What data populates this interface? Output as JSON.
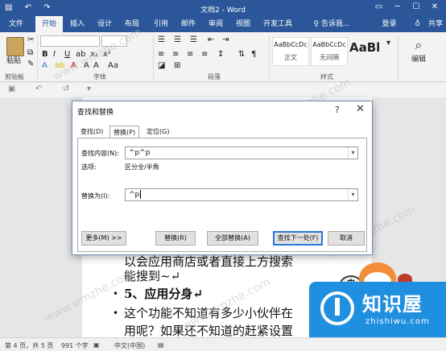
{
  "window": {
    "title": "文档2 - Word"
  },
  "ribbon_tabs": [
    "文件",
    "开始",
    "插入",
    "设计",
    "布局",
    "引用",
    "邮件",
    "审阅",
    "视图",
    "开发工具"
  ],
  "tell_me": "告诉我...",
  "account": {
    "login": "登录",
    "share": "共享"
  },
  "ribbon": {
    "paste_label": "粘贴",
    "clipboard_group": "剪贴板",
    "font_group": "字体",
    "paragraph_group": "段落",
    "styles_group": "样式",
    "edit_label": "编辑",
    "style1_preview": "AaBbCcDc",
    "style1_name": "正文",
    "style2_preview": "AaBbCcDc",
    "style2_name": "无间隔",
    "style3_preview": "AaBl"
  },
  "document": {
    "line1": "以会应用商店或者直接上方搜索",
    "line2": "能搜到~↵",
    "line3": "5、应用分身↵",
    "line4": "这个功能不知道有多少小伙伴在",
    "line5": "用呢？如果还不知道的赶紧设置"
  },
  "watermarks": [
    "www.wmzhe.com",
    "www.wmzhe.com",
    "www.wmzhe.com",
    "www.wmzhe.com",
    "www.wmzhe.com"
  ],
  "dialog": {
    "title": "查找和替换",
    "help": "?",
    "close": "✕",
    "tabs": [
      "查找(D)",
      "替换(P)",
      "定位(G)"
    ],
    "find_label": "查找内容(N):",
    "find_value": "^p^p",
    "options_label": "选项:",
    "options_value": "区分全/半角",
    "replace_label": "替换为(I):",
    "replace_value": "^p",
    "buttons": {
      "more": "更多(M) >>",
      "replace": "替换(R)",
      "replace_all": "全部替换(A)",
      "find_next": "查找下一处(F)",
      "cancel": "取消"
    }
  },
  "status": {
    "page": "第 4 页，共 5 页",
    "words": "991 个字",
    "language": "中文(中国)"
  },
  "badge": {
    "title": "知识屋",
    "url": "zhishiwu.com"
  },
  "mascot_label": "中",
  "colors": {
    "brand": "#2b579a",
    "badge": "#1f8fe0",
    "primary_button_border": "#2b78d8"
  }
}
